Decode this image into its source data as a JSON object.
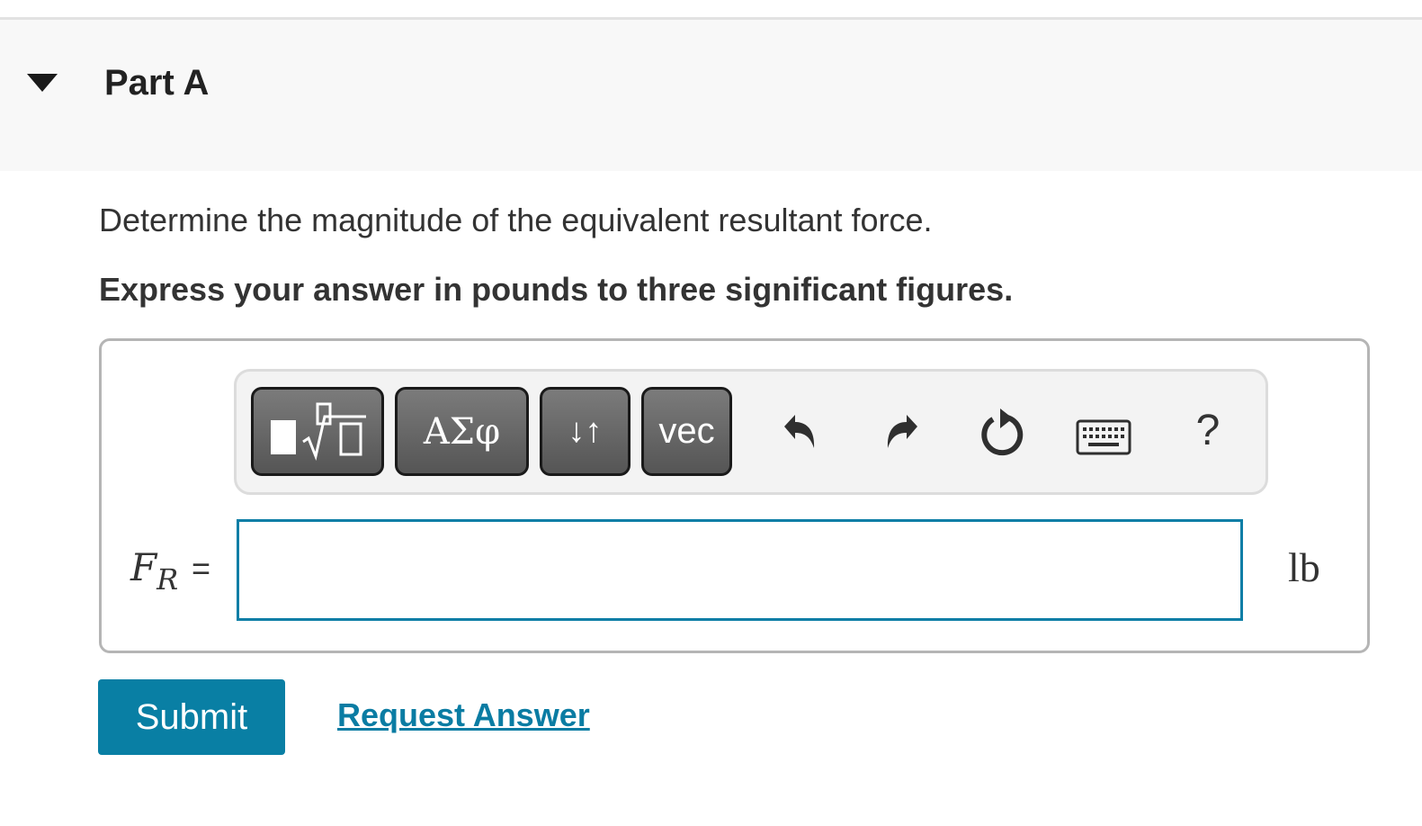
{
  "part": {
    "title": "Part A"
  },
  "question": {
    "prompt": "Determine the magnitude of the equivalent resultant force.",
    "instruction": "Express your answer in pounds to three significant figures."
  },
  "toolbar": {
    "greek_label": "ΑΣφ",
    "updown_label": "↓↑",
    "vec_label": "vec",
    "help_label": "?",
    "icons": [
      "templates-icon",
      "undo-icon",
      "redo-icon",
      "reset-icon",
      "keyboard-icon"
    ]
  },
  "answer": {
    "variable": "F",
    "subscript": "R",
    "equals": "=",
    "value": "",
    "unit": "lb"
  },
  "actions": {
    "submit_label": "Submit",
    "request_label": "Request Answer"
  },
  "colors": {
    "accent": "#097fa4",
    "link": "#0a7ca3",
    "header_bg": "#f8f8f8"
  }
}
